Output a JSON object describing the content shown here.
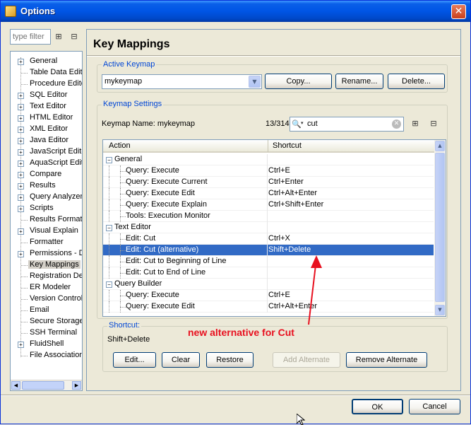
{
  "window": {
    "title": "Options"
  },
  "nav": {
    "filter_placeholder": "type filter",
    "items": [
      {
        "label": "General",
        "expandable": true
      },
      {
        "label": "Table Data Edito",
        "expandable": false
      },
      {
        "label": "Procedure Edito",
        "expandable": false
      },
      {
        "label": "SQL Editor",
        "expandable": true
      },
      {
        "label": "Text Editor",
        "expandable": true
      },
      {
        "label": "HTML Editor",
        "expandable": true
      },
      {
        "label": "XML Editor",
        "expandable": true
      },
      {
        "label": "Java Editor",
        "expandable": true
      },
      {
        "label": "JavaScript Edito",
        "expandable": true
      },
      {
        "label": "AquaScript Edito",
        "expandable": true
      },
      {
        "label": "Compare",
        "expandable": true
      },
      {
        "label": "Results",
        "expandable": true
      },
      {
        "label": "Query Analyzer",
        "expandable": true
      },
      {
        "label": "Scripts",
        "expandable": true
      },
      {
        "label": "Results Format",
        "expandable": false
      },
      {
        "label": "Visual Explain",
        "expandable": true
      },
      {
        "label": "Formatter",
        "expandable": false
      },
      {
        "label": "Permissions - De",
        "expandable": true
      },
      {
        "label": "Key Mappings",
        "expandable": false,
        "selected": true
      },
      {
        "label": "Registration De",
        "expandable": false
      },
      {
        "label": "ER Modeler",
        "expandable": false
      },
      {
        "label": "Version Control",
        "expandable": false
      },
      {
        "label": "Email",
        "expandable": false
      },
      {
        "label": "Secure Storage",
        "expandable": false
      },
      {
        "label": "SSH Terminal",
        "expandable": false
      },
      {
        "label": "FluidShell",
        "expandable": true
      },
      {
        "label": "File Associations",
        "expandable": false
      }
    ]
  },
  "main": {
    "title": "Key Mappings",
    "active_keymap": {
      "legend": "Active Keymap",
      "selected": "mykeymap",
      "copy_label": "Copy...",
      "rename_label": "Rename...",
      "delete_label": "Delete..."
    },
    "keymap_settings": {
      "legend": "Keymap Settings",
      "name_label": "Keymap Name: mykeymap",
      "count": "13/314",
      "search_value": "cut",
      "columns": {
        "action": "Action",
        "shortcut": "Shortcut"
      },
      "rows": [
        {
          "action": "General",
          "shortcut": "",
          "level": 0,
          "group": true
        },
        {
          "action": "Query: Execute",
          "shortcut": "Ctrl+E",
          "level": 1
        },
        {
          "action": "Query: Execute Current",
          "shortcut": "Ctrl+Enter",
          "level": 1
        },
        {
          "action": "Query: Execute Edit",
          "shortcut": "Ctrl+Alt+Enter",
          "level": 1
        },
        {
          "action": "Query: Execute Explain",
          "shortcut": "Ctrl+Shift+Enter",
          "level": 1
        },
        {
          "action": "Tools: Execution Monitor",
          "shortcut": "",
          "level": 1
        },
        {
          "action": "Text Editor",
          "shortcut": "",
          "level": 0,
          "group": true
        },
        {
          "action": "Edit: Cut",
          "shortcut": "Ctrl+X",
          "level": 1
        },
        {
          "action": "Edit: Cut (alternative)",
          "shortcut": "Shift+Delete",
          "level": 1,
          "selected": true
        },
        {
          "action": "Edit: Cut to Beginning of Line",
          "shortcut": "",
          "level": 1
        },
        {
          "action": "Edit: Cut to End of Line",
          "shortcut": "",
          "level": 1
        },
        {
          "action": "Query Builder",
          "shortcut": "",
          "level": 0,
          "group": true
        },
        {
          "action": "Query: Execute",
          "shortcut": "Ctrl+E",
          "level": 1
        },
        {
          "action": "Query: Execute Edit",
          "shortcut": "Ctrl+Alt+Enter",
          "level": 1
        }
      ]
    },
    "shortcut": {
      "legend": "Shortcut:",
      "value": "Shift+Delete",
      "edit_label": "Edit...",
      "clear_label": "Clear",
      "restore_label": "Restore",
      "add_alternate_label": "Add Alternate",
      "remove_alternate_label": "Remove Alternate"
    }
  },
  "annotation": {
    "text": "new alternative for Cut",
    "color": "#e8101f"
  },
  "footer": {
    "ok_label": "OK",
    "cancel_label": "Cancel"
  },
  "colors": {
    "selection": "#316ac5",
    "legend": "#0046d5",
    "title_bar": "#0055e5"
  }
}
